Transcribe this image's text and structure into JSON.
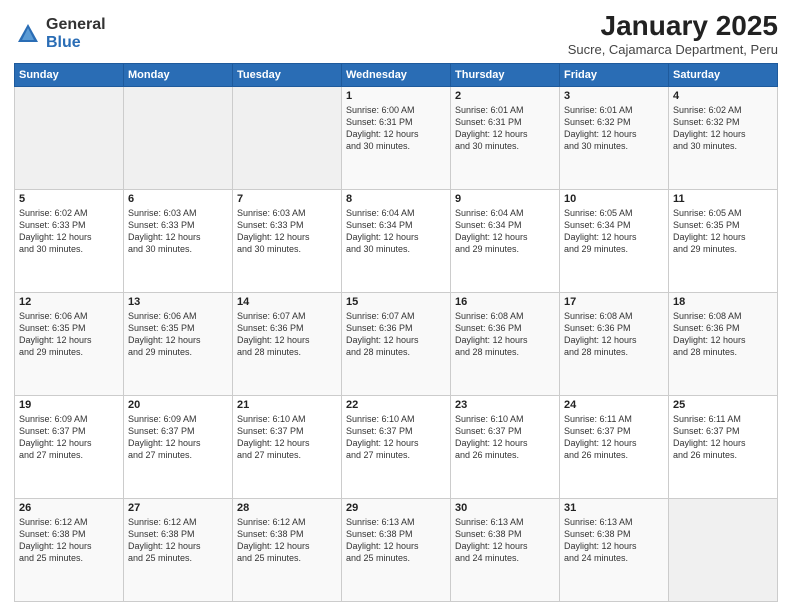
{
  "logo": {
    "general": "General",
    "blue": "Blue"
  },
  "header": {
    "month_year": "January 2025",
    "location": "Sucre, Cajamarca Department, Peru"
  },
  "weekdays": [
    "Sunday",
    "Monday",
    "Tuesday",
    "Wednesday",
    "Thursday",
    "Friday",
    "Saturday"
  ],
  "weeks": [
    [
      {
        "day": "",
        "info": ""
      },
      {
        "day": "",
        "info": ""
      },
      {
        "day": "",
        "info": ""
      },
      {
        "day": "1",
        "info": "Sunrise: 6:00 AM\nSunset: 6:31 PM\nDaylight: 12 hours\nand 30 minutes."
      },
      {
        "day": "2",
        "info": "Sunrise: 6:01 AM\nSunset: 6:31 PM\nDaylight: 12 hours\nand 30 minutes."
      },
      {
        "day": "3",
        "info": "Sunrise: 6:01 AM\nSunset: 6:32 PM\nDaylight: 12 hours\nand 30 minutes."
      },
      {
        "day": "4",
        "info": "Sunrise: 6:02 AM\nSunset: 6:32 PM\nDaylight: 12 hours\nand 30 minutes."
      }
    ],
    [
      {
        "day": "5",
        "info": "Sunrise: 6:02 AM\nSunset: 6:33 PM\nDaylight: 12 hours\nand 30 minutes."
      },
      {
        "day": "6",
        "info": "Sunrise: 6:03 AM\nSunset: 6:33 PM\nDaylight: 12 hours\nand 30 minutes."
      },
      {
        "day": "7",
        "info": "Sunrise: 6:03 AM\nSunset: 6:33 PM\nDaylight: 12 hours\nand 30 minutes."
      },
      {
        "day": "8",
        "info": "Sunrise: 6:04 AM\nSunset: 6:34 PM\nDaylight: 12 hours\nand 30 minutes."
      },
      {
        "day": "9",
        "info": "Sunrise: 6:04 AM\nSunset: 6:34 PM\nDaylight: 12 hours\nand 29 minutes."
      },
      {
        "day": "10",
        "info": "Sunrise: 6:05 AM\nSunset: 6:34 PM\nDaylight: 12 hours\nand 29 minutes."
      },
      {
        "day": "11",
        "info": "Sunrise: 6:05 AM\nSunset: 6:35 PM\nDaylight: 12 hours\nand 29 minutes."
      }
    ],
    [
      {
        "day": "12",
        "info": "Sunrise: 6:06 AM\nSunset: 6:35 PM\nDaylight: 12 hours\nand 29 minutes."
      },
      {
        "day": "13",
        "info": "Sunrise: 6:06 AM\nSunset: 6:35 PM\nDaylight: 12 hours\nand 29 minutes."
      },
      {
        "day": "14",
        "info": "Sunrise: 6:07 AM\nSunset: 6:36 PM\nDaylight: 12 hours\nand 28 minutes."
      },
      {
        "day": "15",
        "info": "Sunrise: 6:07 AM\nSunset: 6:36 PM\nDaylight: 12 hours\nand 28 minutes."
      },
      {
        "day": "16",
        "info": "Sunrise: 6:08 AM\nSunset: 6:36 PM\nDaylight: 12 hours\nand 28 minutes."
      },
      {
        "day": "17",
        "info": "Sunrise: 6:08 AM\nSunset: 6:36 PM\nDaylight: 12 hours\nand 28 minutes."
      },
      {
        "day": "18",
        "info": "Sunrise: 6:08 AM\nSunset: 6:36 PM\nDaylight: 12 hours\nand 28 minutes."
      }
    ],
    [
      {
        "day": "19",
        "info": "Sunrise: 6:09 AM\nSunset: 6:37 PM\nDaylight: 12 hours\nand 27 minutes."
      },
      {
        "day": "20",
        "info": "Sunrise: 6:09 AM\nSunset: 6:37 PM\nDaylight: 12 hours\nand 27 minutes."
      },
      {
        "day": "21",
        "info": "Sunrise: 6:10 AM\nSunset: 6:37 PM\nDaylight: 12 hours\nand 27 minutes."
      },
      {
        "day": "22",
        "info": "Sunrise: 6:10 AM\nSunset: 6:37 PM\nDaylight: 12 hours\nand 27 minutes."
      },
      {
        "day": "23",
        "info": "Sunrise: 6:10 AM\nSunset: 6:37 PM\nDaylight: 12 hours\nand 26 minutes."
      },
      {
        "day": "24",
        "info": "Sunrise: 6:11 AM\nSunset: 6:37 PM\nDaylight: 12 hours\nand 26 minutes."
      },
      {
        "day": "25",
        "info": "Sunrise: 6:11 AM\nSunset: 6:37 PM\nDaylight: 12 hours\nand 26 minutes."
      }
    ],
    [
      {
        "day": "26",
        "info": "Sunrise: 6:12 AM\nSunset: 6:38 PM\nDaylight: 12 hours\nand 25 minutes."
      },
      {
        "day": "27",
        "info": "Sunrise: 6:12 AM\nSunset: 6:38 PM\nDaylight: 12 hours\nand 25 minutes."
      },
      {
        "day": "28",
        "info": "Sunrise: 6:12 AM\nSunset: 6:38 PM\nDaylight: 12 hours\nand 25 minutes."
      },
      {
        "day": "29",
        "info": "Sunrise: 6:13 AM\nSunset: 6:38 PM\nDaylight: 12 hours\nand 25 minutes."
      },
      {
        "day": "30",
        "info": "Sunrise: 6:13 AM\nSunset: 6:38 PM\nDaylight: 12 hours\nand 24 minutes."
      },
      {
        "day": "31",
        "info": "Sunrise: 6:13 AM\nSunset: 6:38 PM\nDaylight: 12 hours\nand 24 minutes."
      },
      {
        "day": "",
        "info": ""
      }
    ]
  ]
}
